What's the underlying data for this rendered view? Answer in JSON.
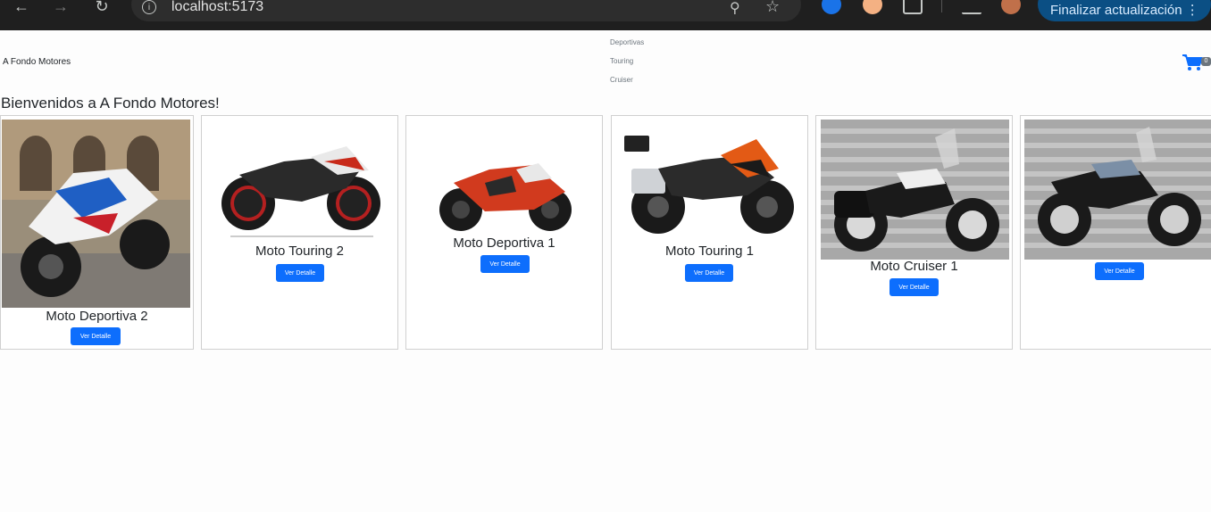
{
  "browser": {
    "url": "localhost:5173",
    "update_label": "Finalizar actualización"
  },
  "navbar": {
    "brand": "A Fondo Motores",
    "links": [
      "Deportivas",
      "Touring",
      "Cruiser"
    ],
    "cart_count": "0"
  },
  "welcome": "Bienvenidos a A Fondo Motores!",
  "products": [
    {
      "title": "Moto Deportiva 2",
      "button": "Ver Detalle"
    },
    {
      "title": "Moto Touring 2",
      "button": "Ver Detalle"
    },
    {
      "title": "Moto Deportiva 1",
      "button": "Ver Detalle"
    },
    {
      "title": "Moto Touring 1",
      "button": "Ver Detalle"
    },
    {
      "title": "Moto Cruiser 1",
      "button": "Ver Detalle"
    },
    {
      "title": "",
      "button": "Ver Detalle"
    }
  ],
  "colors": {
    "primary": "#0d6efd",
    "chrome": "#1f1f1f"
  }
}
